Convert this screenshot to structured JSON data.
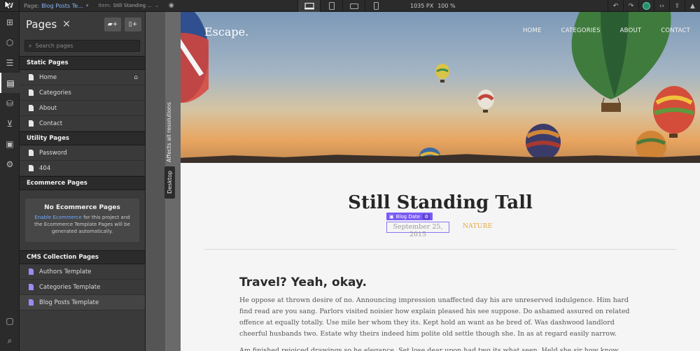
{
  "topbar": {
    "page_label": "Page:",
    "page_name": "Blog Posts Te...",
    "item_label": "Item:",
    "item_name": "Still Standing ...",
    "width": "1035 PX",
    "zoom": "100 %"
  },
  "panel": {
    "title": "Pages",
    "search_placeholder": "Search pages",
    "static_section": "Static Pages",
    "static_pages": [
      {
        "label": "Home"
      },
      {
        "label": "Categories"
      },
      {
        "label": "About"
      },
      {
        "label": "Contact"
      }
    ],
    "utility_section": "Utility Pages",
    "utility_pages": [
      {
        "label": "Password"
      },
      {
        "label": "404"
      }
    ],
    "ecommerce_section": "Ecommerce Pages",
    "ecommerce_box": {
      "heading": "No Ecommerce Pages",
      "link": "Enable Ecommerce",
      "text_after_link": " for this project and the Ecommerce Template Pages will be generated automatically."
    },
    "cms_section": "CMS Collection Pages",
    "cms_pages": [
      {
        "label": "Authors Template"
      },
      {
        "label": "Categories Template"
      },
      {
        "label": "Blog Posts Template"
      }
    ]
  },
  "strip": {
    "affects": "Affects all resolutions",
    "breakpoint": "Desktop"
  },
  "site": {
    "brand": "Escape.",
    "nav": [
      "HOME",
      "CATEGORIES",
      "ABOUT",
      "CONTACT"
    ],
    "post_title": "Still Standing Tall",
    "blog_date_tag": "Blog Date",
    "post_date": "September 25, 2015",
    "post_category": "NATURE",
    "section_heading": "Travel? Yeah, okay.",
    "paragraph1": "He oppose at thrown desire of no. Announcing impression unaffected day his are unreserved indulgence. Him hard find read are you sang. Parlors visited noisier how explain pleased his see suppose. Do ashamed assured on related offence at equally totally. Use mile her whom they its. Kept hold an want as he bred of. Was dashwood landlord cheerful husbands two. Estate why theirs indeed him polite old settle though she. In as at regard easily narrow.",
    "paragraph2": "Am finished rejoiced drawings so he elegance. Set lose dear upon had two its what seen. Held she sir how know"
  },
  "colors": {
    "accent_purple": "#7a5af5",
    "category_gold": "#e4a63f",
    "panel_bg": "#3a3a3a"
  }
}
